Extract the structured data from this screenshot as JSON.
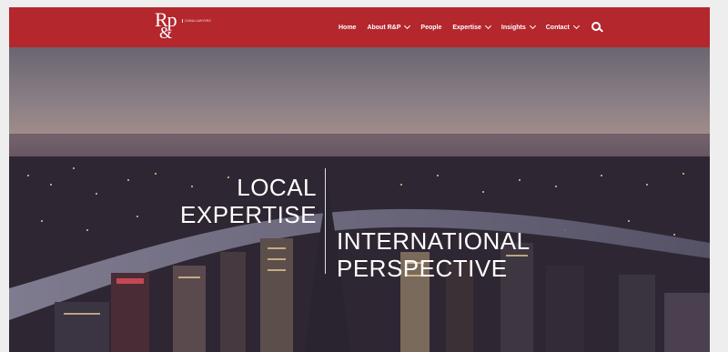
{
  "logo": {
    "mark": "Rp",
    "amp": "&",
    "subtitle": "CHINA LAWYERS"
  },
  "nav": {
    "items": [
      {
        "label": "Home",
        "has_dropdown": false
      },
      {
        "label": "About R&P",
        "has_dropdown": true
      },
      {
        "label": "People",
        "has_dropdown": false
      },
      {
        "label": "Expertise",
        "has_dropdown": true
      },
      {
        "label": "Insights",
        "has_dropdown": true
      },
      {
        "label": "Contact",
        "has_dropdown": true
      }
    ],
    "search_icon": "search-icon"
  },
  "hero": {
    "left_line1": "LOCAL",
    "left_line2": "EXPERTISE",
    "right_line1": "INTERNATIONAL",
    "right_line2": "PERSPECTIVE"
  },
  "colors": {
    "header_red": "#b3272d",
    "text_white": "#ffffff"
  }
}
